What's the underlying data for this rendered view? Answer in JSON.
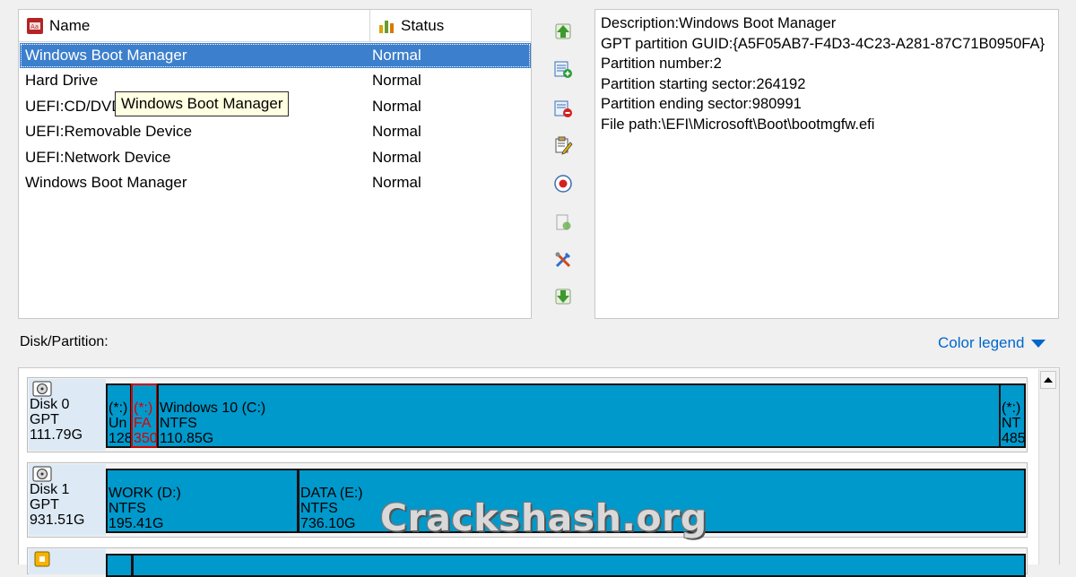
{
  "list": {
    "col_name": "Name",
    "col_status": "Status",
    "rows": [
      {
        "name": "Windows Boot Manager",
        "status": "Normal"
      },
      {
        "name": "Hard Drive",
        "status": "Normal"
      },
      {
        "name": "UEFI:CD/DVD Drive",
        "status": "Normal"
      },
      {
        "name": "UEFI:Removable Device",
        "status": "Normal"
      },
      {
        "name": "UEFI:Network Device",
        "status": "Normal"
      },
      {
        "name": "Windows Boot Manager",
        "status": "Normal"
      }
    ],
    "selected_row": 0,
    "tooltip": "Windows Boot Manager"
  },
  "toolbar": {
    "icons": [
      "move-up-icon",
      "add-entry-icon",
      "delete-entry-icon",
      "edit-entry-icon",
      "set-default-icon",
      "backup-icon",
      "tools-icon",
      "move-down-icon"
    ]
  },
  "details": {
    "lines": [
      "Description:Windows Boot Manager",
      "GPT partition GUID:{A5F05AB7-F4D3-4C23-A281-87C71B0950FA}",
      "Partition number:2",
      "Partition starting sector:264192",
      "Partition ending sector:980991",
      "File path:\\EFI\\Microsoft\\Boot\\bootmgfw.efi"
    ]
  },
  "disk_panel": {
    "label": "Disk/Partition:",
    "legend": "Color legend"
  },
  "disks": [
    {
      "name": "Disk 0",
      "type": "GPT",
      "size": "111.79G",
      "partitions": [
        {
          "l1": "(*:)",
          "l2": "Un",
          "l3": "128"
        },
        {
          "l1": "(*:)",
          "l2": "FA",
          "l3": "350"
        },
        {
          "l1": "Windows 10 (C:)",
          "l2": "NTFS",
          "l3": "110.85G"
        },
        {
          "l1": "(*:)",
          "l2": "NT",
          "l3": "485"
        }
      ]
    },
    {
      "name": "Disk 1",
      "type": "GPT",
      "size": "931.51G",
      "partitions": [
        {
          "l1": "WORK (D:)",
          "l2": "NTFS",
          "l3": "195.41G"
        },
        {
          "l1": "DATA (E:)",
          "l2": "NTFS",
          "l3": "736.10G"
        }
      ]
    }
  ],
  "watermark": "Crackshash.org",
  "colors": {
    "selection": "#3c7fcc",
    "partition": "#0099cc",
    "legend_link": "#0066cc",
    "tooltip_bg": "#ffffe1"
  }
}
